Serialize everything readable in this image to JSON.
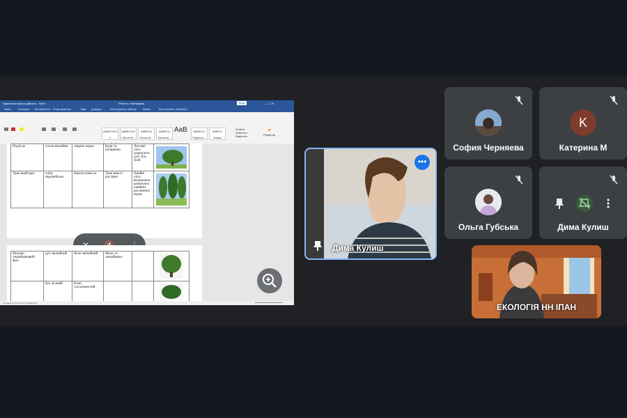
{
  "word": {
    "title_left": "Практична Кулиш Дмитро - Word",
    "title_center": "Робота з таблицями",
    "signin": "Вхід",
    "tabs": [
      "Файл",
      "Основна",
      "Вставлення",
      "Рецензування",
      "Вид",
      "Довідка",
      "Конструктор таблиці",
      "Макет"
    ],
    "tell_me": "Що потрібно зробити?",
    "styles": [
      "AaBbCcDd",
      "AaBbCcDc",
      "AaBbCcI",
      "AaBbCcI",
      "AaBbCcC",
      "AaBbCc"
    ],
    "style_names": [
      "1 Звичайний",
      "1 Без інте...",
      "Заголов...",
      "Заголов...",
      "Назва",
      "Підзагол..."
    ],
    "aab": "AaB",
    "find": "Знайти",
    "replace": "Замінити",
    "select": "Виділити",
    "editor": "Редактор",
    "table1": [
      [
        "Підлісок",
        "сосна звичайна",
        "ліщина черна",
        "Кущі та чагарники",
        "Листяні ліси: домінують дуб, бук, граб.",
        ""
      ],
      [
        "Трав`яний ярус",
        "кліщ європейська",
        "Береза повисла",
        "Трав`янисті рослини",
        "Хвойні ліси: включають домінуючі хвойних рослинних видів.",
        ""
      ]
    ],
    "table2": [
      [
        "Мохово-лишайниковий ярус",
        "дуб звичайний",
        "Ясен звичайний",
        "Мохи та лишайники",
        ""
      ],
      [
        "",
        "бук лісовий",
        "Клен сосгрошистий",
        "",
        ""
      ]
    ],
    "status": "Сторінка 4 з 5   Слів: 517   українська"
  },
  "participants": [
    {
      "name": "София Черняева",
      "muted": true
    },
    {
      "name": "Катерина М",
      "initial": "K",
      "muted": true
    },
    {
      "name": "Ольга Губська",
      "muted": true
    },
    {
      "name": "Дима Кулиш",
      "muted": true
    }
  ],
  "spotlight": {
    "name": "Дима Кулиш",
    "more_label": "•••"
  },
  "camera_tile": {
    "name": "ЕКОЛОГІЯ НН ІПАН"
  },
  "colors": {
    "accent": "#1a73e8",
    "word_blue": "#2b579a",
    "tile_bg": "#3c4043",
    "avatar_k": "#7e3b2e"
  }
}
